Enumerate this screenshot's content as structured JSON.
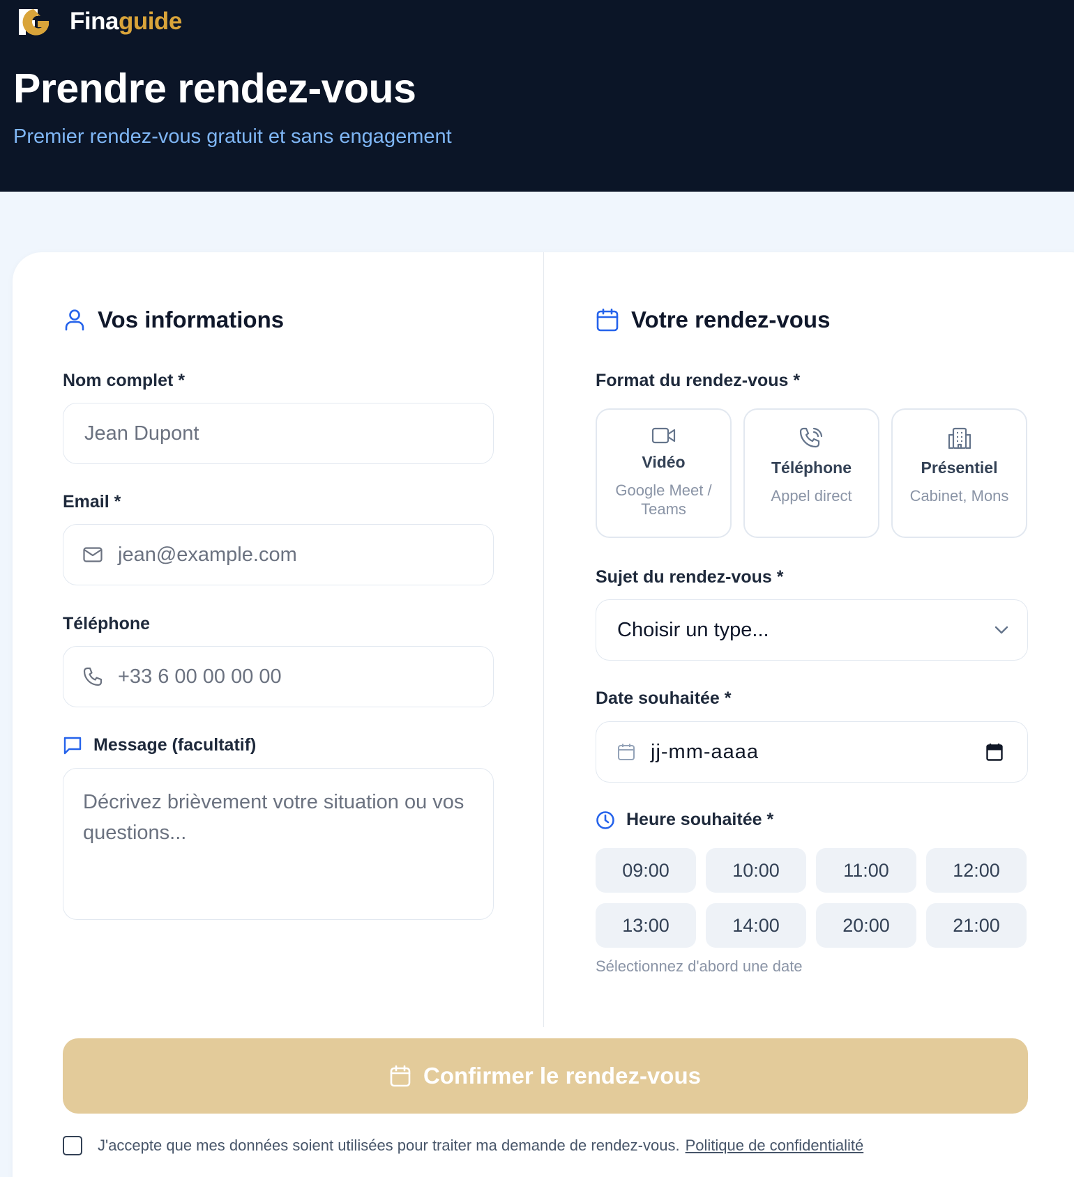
{
  "brand": {
    "logo_icon": "fg-logo",
    "name_part1": "Fina",
    "name_part2": "guide",
    "accent_color": "#d9a43a"
  },
  "hero": {
    "title": "Prendre rendez-vous",
    "subtitle": "Premier rendez-vous gratuit et sans engagement",
    "background": "#0b1527"
  },
  "info_section": {
    "title": "Vos informations",
    "icon": "user-icon",
    "name_label": "Nom complet *",
    "name_placeholder": "Jean Dupont",
    "email_label": "Email *",
    "email_placeholder": "jean@example.com",
    "phone_label": "Téléphone",
    "phone_placeholder": "+33 6 00 00 00 00",
    "message_label": "Message (facultatif)",
    "message_placeholder": "Décrivez brièvement votre situation ou vos questions..."
  },
  "rdv_section": {
    "title": "Votre rendez-vous",
    "icon": "calendar-icon",
    "format_label": "Format du rendez-vous *",
    "formats": [
      {
        "title": "Vidéo",
        "desc": "Google Meet / Teams",
        "icon": "video-icon"
      },
      {
        "title": "Téléphone",
        "desc": "Appel direct",
        "icon": "phone-icon"
      },
      {
        "title": "Présentiel",
        "desc": "Cabinet, Mons",
        "icon": "building-icon"
      }
    ],
    "subject_label": "Sujet du rendez-vous *",
    "subject_value": "Choisir un type...",
    "date_label": "Date souhaitée *",
    "date_value": "jj-mm-aaaa",
    "time_label": "Heure souhaitée *",
    "time_slots": [
      "09:00",
      "10:00",
      "11:00",
      "12:00",
      "13:00",
      "14:00",
      "20:00",
      "21:00"
    ],
    "time_hint": "Sélectionnez d'abord une date"
  },
  "confirm": {
    "label": "Confirmer le rendez-vous",
    "color": "#e3cb9a"
  },
  "consent": {
    "text": "J'accepte que mes données soient utilisées pour traiter ma demande de rendez-vous.",
    "link": "Politique de confidentialité",
    "checked": false
  }
}
